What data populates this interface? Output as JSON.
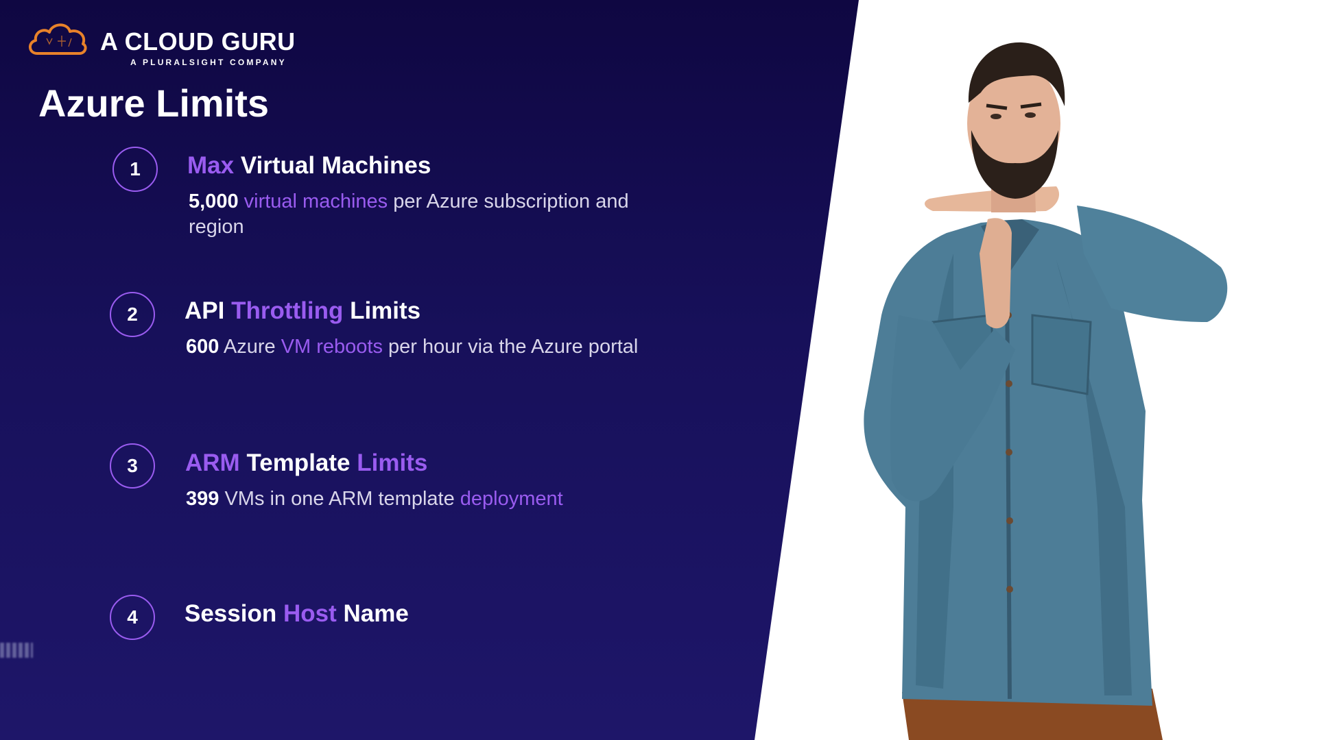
{
  "brand": {
    "name": "A CLOUD GURU",
    "tagline": "A PLURALSIGHT COMPANY",
    "accent_color": "#e8822a"
  },
  "title": "Azure Limits",
  "colors": {
    "accent": "#9a5cf0",
    "background": "#140c50",
    "text": "#ffffff"
  },
  "items": [
    {
      "number": "1",
      "heading": {
        "a": "Max",
        "b": " Virtual Machines"
      },
      "desc": {
        "a": "5,000",
        "b": " ",
        "c": "virtual machines",
        "d": " per Azure subscription and region"
      }
    },
    {
      "number": "2",
      "heading": {
        "a": "API ",
        "b": "Throttling",
        "c": " Limits"
      },
      "desc": {
        "a": "600",
        "b": " Azure ",
        "c": "VM reboots",
        "d": " per hour via the Azure portal"
      }
    },
    {
      "number": "3",
      "heading": {
        "a": "ARM",
        "b": " Template ",
        "c": "Limits"
      },
      "desc": {
        "a": "399",
        "b": " VMs in one ARM template ",
        "c": "deployment"
      }
    },
    {
      "number": "4",
      "heading": {
        "a": "Session ",
        "b": "Host",
        "c": " Name"
      }
    }
  ],
  "image": {
    "icon": "presenter-timeout-gesture"
  }
}
